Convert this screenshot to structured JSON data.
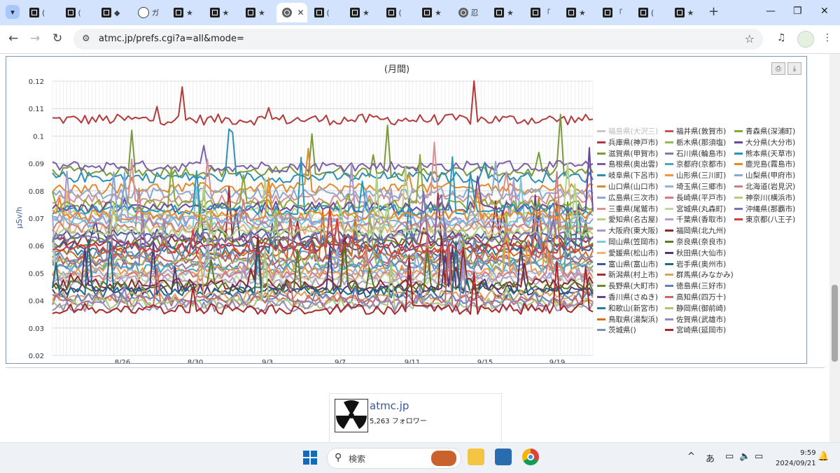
{
  "browser": {
    "tabs": [
      {
        "title": "(",
        "icon": "site-favicon"
      },
      {
        "title": "(",
        "icon": "site-favicon"
      },
      {
        "title": "◆",
        "icon": "site-favicon"
      },
      {
        "title": "ガ",
        "icon": "info-favicon"
      },
      {
        "title": "★",
        "icon": "site-favicon"
      },
      {
        "title": "★",
        "icon": "site-favicon"
      },
      {
        "title": "★",
        "icon": "site-favicon"
      },
      {
        "title": "",
        "icon": "globe-favicon",
        "active": true
      },
      {
        "title": "(",
        "icon": "site-favicon"
      },
      {
        "title": "★",
        "icon": "site-favicon"
      },
      {
        "title": "(",
        "icon": "site-favicon"
      },
      {
        "title": "★",
        "icon": "site-favicon"
      },
      {
        "title": "忍",
        "icon": "globe-favicon"
      },
      {
        "title": "★",
        "icon": "site-favicon"
      },
      {
        "title": "「",
        "icon": "site-favicon"
      },
      {
        "title": "★",
        "icon": "site-favicon"
      },
      {
        "title": "「",
        "icon": "site-favicon"
      },
      {
        "title": "(",
        "icon": "site-favicon"
      },
      {
        "title": "★",
        "icon": "site-favicon"
      }
    ],
    "url": "atmc.jp/prefs.cgi?a=all&mode="
  },
  "chart_data": {
    "type": "line",
    "title": "(月間)",
    "ylabel": "μSv/h",
    "ylim": [
      0.02,
      0.12
    ],
    "yticks": [
      "0.12",
      "0.11",
      "0.1",
      "0.09",
      "0.08",
      "0.07",
      "0.06",
      "0.05",
      "0.04",
      "0.03",
      "0.02"
    ],
    "xticks": [
      "8/26",
      "8/30",
      "9/3",
      "9/7",
      "9/11",
      "9/15",
      "9/19"
    ],
    "legend_position": "right",
    "series": [
      {
        "name": "福島県(大沢三)",
        "color": "#c8c8c8",
        "base": null
      },
      {
        "name": "兵庫県(神戸市)",
        "color": "#b33a3a",
        "base": 0.106
      },
      {
        "name": "滋賀県(甲賀市)",
        "color": "#7a9a3a",
        "base": 0.087
      },
      {
        "name": "島根県(奥出雲)",
        "color": "#7b5fa6",
        "base": 0.089
      },
      {
        "name": "岐阜県(下呂市)",
        "color": "#2f8fb3",
        "base": 0.085
      },
      {
        "name": "山口県(山口市)",
        "color": "#e08a2e",
        "base": 0.081
      },
      {
        "name": "広島県(三次市)",
        "color": "#8fa8d0",
        "base": 0.079
      },
      {
        "name": "三重県(尾鷲市)",
        "color": "#d89090",
        "base": 0.077
      },
      {
        "name": "愛知県(名古屋)",
        "color": "#b8d08a",
        "base": 0.072
      },
      {
        "name": "大阪府(東大阪)",
        "color": "#a898c8",
        "base": 0.07
      },
      {
        "name": "岡山県(笠岡市)",
        "color": "#7cc8d8",
        "base": 0.068
      },
      {
        "name": "愛媛県(松山市)",
        "color": "#f0b078",
        "base": 0.066
      },
      {
        "name": "富山県(富山市)",
        "color": "#3a5a9a",
        "base": 0.064
      },
      {
        "name": "新潟県(村上市)",
        "color": "#a03030",
        "base": 0.062
      },
      {
        "name": "長野県(大町市)",
        "color": "#6a8a2a",
        "base": 0.061
      },
      {
        "name": "香川県(さぬき)",
        "color": "#60488a",
        "base": 0.06
      },
      {
        "name": "和歌山(新宮市)",
        "color": "#2a7a9a",
        "base": 0.058
      },
      {
        "name": "鳥取県(湯梨浜)",
        "color": "#d07020",
        "base": 0.057
      },
      {
        "name": "茨城県()",
        "color": "#7890c0",
        "base": 0.056
      },
      {
        "name": "福井県(敦賀市)",
        "color": "#c05858",
        "base": 0.055
      },
      {
        "name": "栃木県(那須塩)",
        "color": "#98b860",
        "base": 0.054
      },
      {
        "name": "石川県(輪島市)",
        "color": "#8878b0",
        "base": 0.053
      },
      {
        "name": "京都府(京都市)",
        "color": "#48a8c0",
        "base": 0.052
      },
      {
        "name": "山形県(三川町)",
        "color": "#f09848",
        "base": 0.051
      },
      {
        "name": "埼玉県(三郷市)",
        "color": "#98b0d8",
        "base": 0.05
      },
      {
        "name": "長崎県(平戸市)",
        "color": "#d87878",
        "base": 0.049
      },
      {
        "name": "宮城県(丸森町)",
        "color": "#c0d8a0",
        "base": 0.048
      },
      {
        "name": "千葉県(香取市)",
        "color": "#b0a0d0",
        "base": 0.047
      },
      {
        "name": "福岡県(北九州)",
        "color": "#8a2a2a",
        "base": 0.046
      },
      {
        "name": "奈良県(奈良市)",
        "color": "#587a20",
        "base": 0.045
      },
      {
        "name": "秋田県(大仙市)",
        "color": "#503878",
        "base": 0.044
      },
      {
        "name": "岩手県(奥州市)",
        "color": "#1a6a88",
        "base": 0.043
      },
      {
        "name": "群馬県(みなかみ)",
        "color": "#e0a060",
        "base": 0.042
      },
      {
        "name": "徳島県(三好市)",
        "color": "#6880b8",
        "base": 0.041
      },
      {
        "name": "高知県(四万十)",
        "color": "#c86868",
        "base": 0.04
      },
      {
        "name": "静岡県(御前崎)",
        "color": "#a8c878",
        "base": 0.039
      },
      {
        "name": "佐賀県(武雄市)",
        "color": "#9888c0",
        "base": 0.038
      },
      {
        "name": "宮崎県(延岡市)",
        "color": "#a82828",
        "base": 0.037
      },
      {
        "name": "青森県(深浦町)",
        "color": "#88a838",
        "base": 0.075
      },
      {
        "name": "大分県(大分市)",
        "color": "#6848a0",
        "base": 0.074
      },
      {
        "name": "熊本県(天草市)",
        "color": "#2898b8",
        "base": 0.073
      },
      {
        "name": "鹿児島(霧島市)",
        "color": "#e88828",
        "base": 0.071
      },
      {
        "name": "山梨県(甲府市)",
        "color": "#88a8d8",
        "base": 0.069
      },
      {
        "name": "北海道(岩見沢)",
        "color": "#c88080",
        "base": 0.067
      },
      {
        "name": "神奈川(横浜市)",
        "color": "#b0d080",
        "base": 0.065
      },
      {
        "name": "沖縄県(那覇市)",
        "color": "#8070b0",
        "base": 0.063
      },
      {
        "name": "東京都(八王子)",
        "color": "#d04040",
        "base": 0.059
      }
    ]
  },
  "export": {
    "print_icon": "printer-icon",
    "download_icon": "download-icon"
  },
  "facebook_card": {
    "name": "atmc.jp",
    "followers": "5,263 フォロワー"
  },
  "taskbar": {
    "search_placeholder": "検索",
    "ime": "あ",
    "time": "9:59",
    "date": "2024/09/21"
  }
}
